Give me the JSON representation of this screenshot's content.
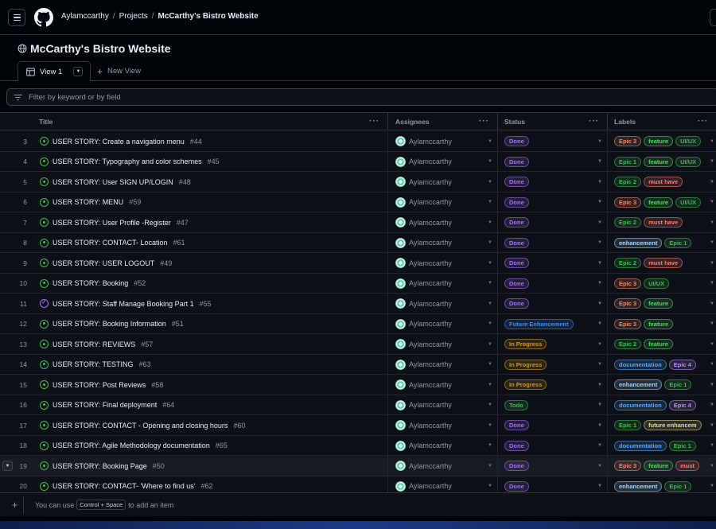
{
  "header": {
    "owner": "Aylamccarthy",
    "projects": "Projects",
    "current": "McCarthy's Bistro Website",
    "separator": "/"
  },
  "project": {
    "title": "McCarthy's Bistro Website"
  },
  "tabs": {
    "active_label": "View 1",
    "new_label": "New View"
  },
  "filter": {
    "placeholder": "Filter by keyword or by field"
  },
  "columns": {
    "title": "Title",
    "assignees": "Assignees",
    "status": "Status",
    "labels": "Labels"
  },
  "colors": {
    "Done": "#a371f7",
    "In Progress": "#d29922",
    "Future Enhancement": "#388bfd",
    "Todo": "#3fb950",
    "Epic 1": "#3fb950",
    "Epic 2": "#3fb950",
    "Epic 3": "#f0886b",
    "Epic 4": "#bc8cff",
    "feature": "#56d364",
    "UI/UX": "#3fb950",
    "must have": "#ff7b72",
    "enhancement": "#a5d6ff",
    "documentation": "#58a6ff",
    "future enhancement": "#e3d9a0"
  },
  "rows": [
    {
      "n": "3",
      "title": "USER STORY: Create a navigation menu",
      "issue": "#44",
      "state": "open",
      "assignee": "Aylamccarthy",
      "status": "Done",
      "labels": [
        "Epic 3",
        "feature",
        "UI/UX"
      ]
    },
    {
      "n": "4",
      "title": "USER STORY: Typography and color schemes",
      "issue": "#45",
      "state": "open",
      "assignee": "Aylamccarthy",
      "status": "Done",
      "labels": [
        "Epic 1",
        "feature",
        "UI/UX"
      ]
    },
    {
      "n": "5",
      "title": "USER STORY: User SIGN UP/LOGIN",
      "issue": "#48",
      "state": "open",
      "assignee": "Aylamccarthy",
      "status": "Done",
      "labels": [
        "Epic 2",
        "must have"
      ]
    },
    {
      "n": "6",
      "title": "USER STORY: MENU",
      "issue": "#59",
      "state": "open",
      "assignee": "Aylamccarthy",
      "status": "Done",
      "labels": [
        "Epic 3",
        "feature",
        "UI/UX"
      ]
    },
    {
      "n": "7",
      "title": "USER STORY: User Profile -Register",
      "issue": "#47",
      "state": "open",
      "assignee": "Aylamccarthy",
      "status": "Done",
      "labels": [
        "Epic 2",
        "must have"
      ]
    },
    {
      "n": "8",
      "title": "USER STORY: CONTACT- Location",
      "issue": "#61",
      "state": "open",
      "assignee": "Aylamccarthy",
      "status": "Done",
      "labels": [
        "enhancement",
        "Epic 1"
      ]
    },
    {
      "n": "9",
      "title": "USER STORY: USER LOGOUT",
      "issue": "#49",
      "state": "open",
      "assignee": "Aylamccarthy",
      "status": "Done",
      "labels": [
        "Epic 2",
        "must have"
      ]
    },
    {
      "n": "10",
      "title": "USER STORY: Booking",
      "issue": "#52",
      "state": "open",
      "assignee": "Aylamccarthy",
      "status": "Done",
      "labels": [
        "Epic 3",
        "UI/UX"
      ]
    },
    {
      "n": "11",
      "title": "USER STORY: Staff Manage Booking Part 1",
      "issue": "#55",
      "state": "closed",
      "assignee": "Aylamccarthy",
      "status": "Done",
      "labels": [
        "Epic 3",
        "feature"
      ]
    },
    {
      "n": "12",
      "title": "USER STORY: Booking Information",
      "issue": "#51",
      "state": "open",
      "assignee": "Aylamccarthy",
      "status": "Future Enhancement",
      "labels": [
        "Epic 3",
        "feature"
      ]
    },
    {
      "n": "13",
      "title": "USER STORY: REVIEWS",
      "issue": "#57",
      "state": "open",
      "assignee": "Aylamccarthy",
      "status": "In Progress",
      "labels": [
        "Epic 2",
        "feature"
      ]
    },
    {
      "n": "14",
      "title": "USER STORY: TESTING",
      "issue": "#63",
      "state": "open",
      "assignee": "Aylamccarthy",
      "status": "In Progress",
      "labels": [
        "documentation",
        "Epic 4"
      ]
    },
    {
      "n": "15",
      "title": "USER STORY: Post Reviews",
      "issue": "#58",
      "state": "open",
      "assignee": "Aylamccarthy",
      "status": "In Progress",
      "labels": [
        "enhancement",
        "Epic 1"
      ]
    },
    {
      "n": "16",
      "title": "USER STORY: Final deployment",
      "issue": "#64",
      "state": "open",
      "assignee": "Aylamccarthy",
      "status": "Todo",
      "labels": [
        "documentation",
        "Epic 4"
      ]
    },
    {
      "n": "17",
      "title": "USER STORY: CONTACT - Opening and closing hours",
      "issue": "#60",
      "state": "open",
      "assignee": "Aylamccarthy",
      "status": "Done",
      "labels": [
        "Epic 1",
        "future enhancem"
      ]
    },
    {
      "n": "18",
      "title": "USER STORY: Agile Methodology documentation",
      "issue": "#65",
      "state": "open",
      "assignee": "Aylamccarthy",
      "status": "Done",
      "labels": [
        "documentation",
        "Epic 1"
      ]
    },
    {
      "n": "19",
      "title": "USER STORY: Booking Page",
      "issue": "#50",
      "state": "open",
      "assignee": "Aylamccarthy",
      "status": "Done",
      "labels": [
        "Epic 3",
        "feature",
        "must"
      ],
      "highlighted": true
    },
    {
      "n": "20",
      "title": "USER STORY: CONTACT- 'Where to find us'",
      "issue": "#62",
      "state": "open",
      "assignee": "Aylamccarthy",
      "status": "Done",
      "labels": [
        "enhancement",
        "Epic 1"
      ]
    }
  ],
  "footer": {
    "hint_before": "You can use",
    "kbd": "Control + Space",
    "hint_after": "to add an item"
  }
}
